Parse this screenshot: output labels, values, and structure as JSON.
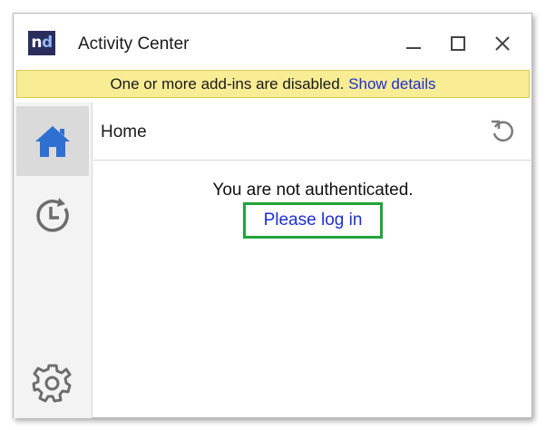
{
  "window": {
    "title": "Activity Center",
    "logo_text_n": "n",
    "logo_text_d": "d",
    "controls": [
      "minimize",
      "maximize",
      "close"
    ]
  },
  "notice": {
    "message": "One or more add-ins are disabled.",
    "link": "Show details"
  },
  "sidebar": {
    "items": [
      {
        "icon": "home-icon",
        "selected": true
      },
      {
        "icon": "history-icon",
        "selected": false
      },
      {
        "icon": "gear-icon",
        "selected": false
      }
    ]
  },
  "main": {
    "title": "Home",
    "status": "You are not authenticated.",
    "login_link": "Please log in"
  },
  "colors": {
    "accent": "#2f6fd1",
    "notice_bg": "#f8ec95",
    "link": "#1d2fd6",
    "highlight_border": "#22a33b",
    "logo_bg": "#2b2d5c"
  }
}
